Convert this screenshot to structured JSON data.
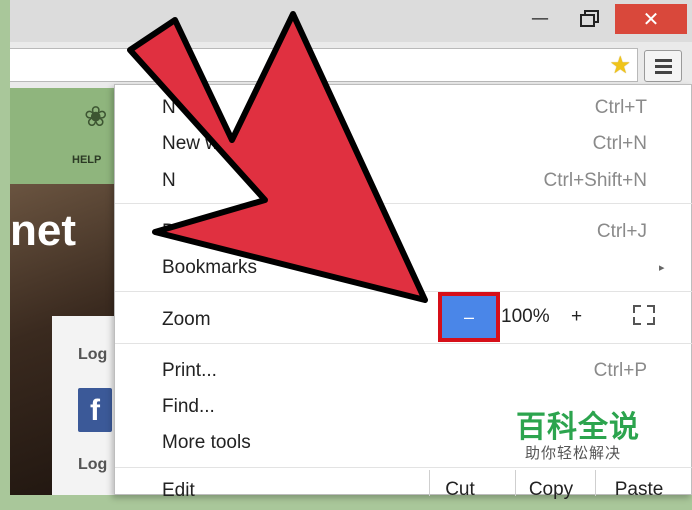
{
  "window": {
    "minimize_icon": "minimize-icon",
    "maximize_icon": "maximize-icon",
    "close_icon": "close-icon",
    "close_color": "#d9483b"
  },
  "toolbar": {
    "bookmark_star": "star-icon",
    "menu_icon": "hamburger-menu-icon"
  },
  "background_page": {
    "nav_label": "HELP",
    "hero_text": "net",
    "login_label_1": "Log",
    "facebook_glyph": "f",
    "login_label_2": "Log",
    "accent_color": "#8fb57d"
  },
  "menu": {
    "items": [
      {
        "label": "N",
        "shortcut": "Ctrl+T"
      },
      {
        "label": "New w",
        "shortcut": "Ctrl+N"
      },
      {
        "label": "N",
        "shortcut": "Ctrl+Shift+N"
      },
      {
        "label": "Downlo",
        "shortcut": "Ctrl+J"
      },
      {
        "label": "Bookmarks",
        "shortcut": ""
      },
      {
        "label": "Print...",
        "shortcut": "Ctrl+P"
      },
      {
        "label": "Find...",
        "shortcut": ""
      },
      {
        "label": "More tools",
        "shortcut": ""
      }
    ],
    "bookmarks_arrow": "▸",
    "zoom": {
      "label": "Zoom",
      "minus": "–",
      "level": "100%",
      "plus": "+",
      "minus_highlight_color": "#d60f19",
      "minus_button_color": "#4a86e8"
    },
    "edit": {
      "label": "Edit",
      "cut": "Cut",
      "copy": "Copy",
      "paste": "Paste"
    }
  },
  "annotation": {
    "arrow_color": "#e03040"
  },
  "watermark": {
    "title": "百科全说",
    "subtitle": "助你轻松解决",
    "color": "#2ca44e"
  }
}
